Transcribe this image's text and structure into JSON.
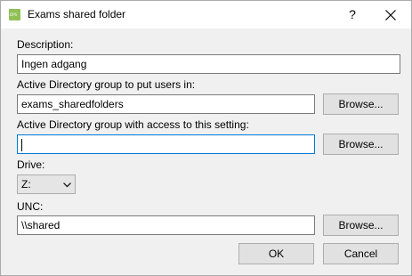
{
  "window": {
    "title": "Exams shared folder",
    "icon_text": "DPS",
    "help_label": "?",
    "icons": {
      "app": "app-icon",
      "help": "help-icon",
      "close": "close-icon"
    }
  },
  "form": {
    "description": {
      "label": "Description:",
      "value": "Ingen adgang"
    },
    "ad_group": {
      "label": "Active Directory group to put users in:",
      "value": "exams_sharedfolders",
      "browse_label": "Browse..."
    },
    "ad_access": {
      "label": "Active Directory group with access to this setting:",
      "value": "",
      "browse_label": "Browse..."
    },
    "drive": {
      "label": "Drive:",
      "value": "Z:"
    },
    "unc": {
      "label": "UNC:",
      "value": "\\\\shared",
      "browse_label": "Browse..."
    }
  },
  "footer": {
    "ok_label": "OK",
    "cancel_label": "Cancel"
  },
  "colors": {
    "focus_border": "#0078d7",
    "icon_green": "#8fc156",
    "button_face": "#e1e1e1"
  }
}
